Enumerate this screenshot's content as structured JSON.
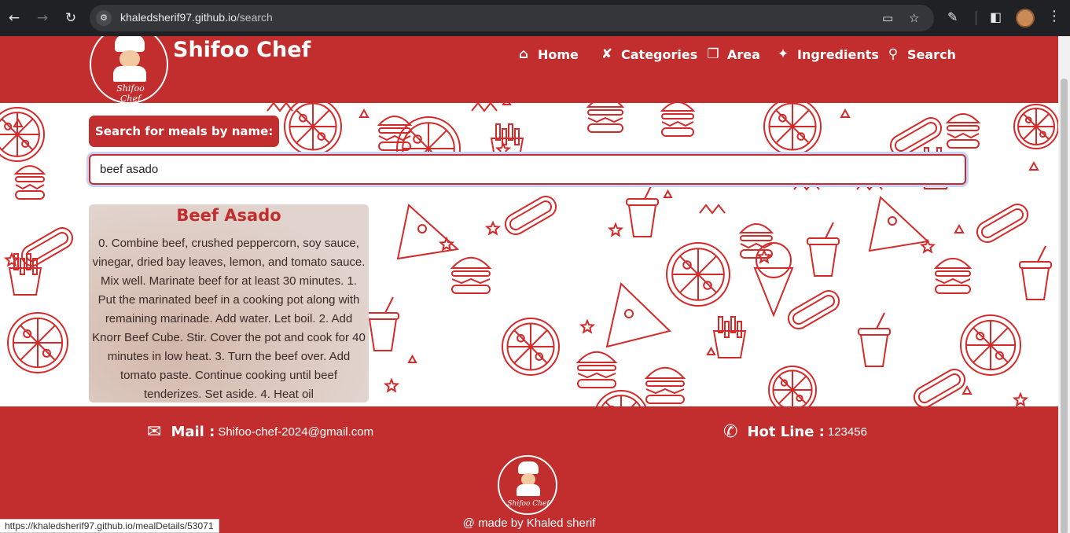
{
  "browser": {
    "url_host": "khaledsherif97.github.io",
    "url_path": "/search",
    "status_url": "https://khaledsherif97.github.io/mealDetails/53071"
  },
  "brand": {
    "name": "Shifoo Chef",
    "logo_text": "Shifoo Chef"
  },
  "nav": {
    "items": [
      {
        "label": "Home",
        "icon": "home-icon"
      },
      {
        "label": "Categories",
        "icon": "utensils-icon"
      },
      {
        "label": "Area",
        "icon": "map-icon"
      },
      {
        "label": "Ingredients",
        "icon": "drumstick-icon"
      },
      {
        "label": "Search",
        "icon": "search-icon"
      }
    ]
  },
  "search": {
    "label": "Search for meals by name:",
    "value": "beef asado"
  },
  "results": [
    {
      "title": "Beef Asado",
      "description": "0. Combine beef, crushed peppercorn, soy sauce, vinegar, dried bay leaves, lemon, and tomato sauce. Mix well. Marinate beef for at least 30 minutes. 1. Put the marinated beef in a cooking pot along with remaining marinade. Add water. Let boil. 2. Add Knorr Beef Cube. Stir. Cover the pot and cook for 40 minutes in low heat. 3. Turn the beef over. Add tomato paste. Continue cooking until beef tenderizes. Set aside. 4. Heat oil"
    }
  ],
  "footer": {
    "mail_label": "Mail :",
    "mail_value": "Shifoo-chef-2024@gmail.com",
    "hotline_label": "Hot Line :",
    "hotline_value": "123456",
    "made_by": "@ made by Khaled sherif"
  },
  "colors": {
    "brand_red": "#c22d2e",
    "pattern_red": "#d42a2a"
  }
}
